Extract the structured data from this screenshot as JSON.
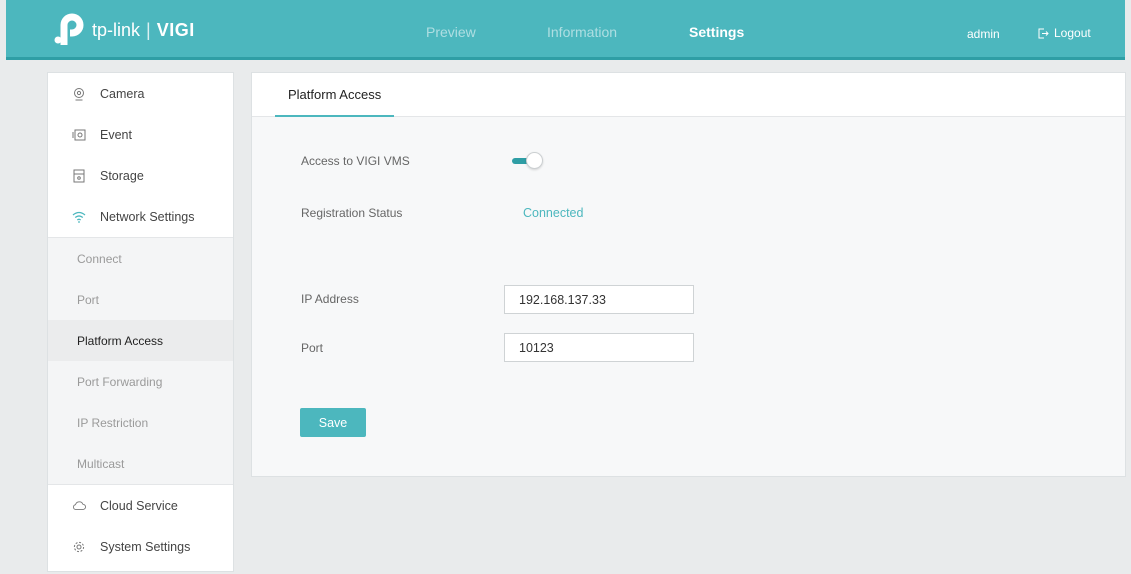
{
  "header": {
    "logo_brand": "tp-link",
    "logo_separator": "|",
    "logo_product": "VIGI",
    "nav": [
      {
        "label": "Preview",
        "active": false
      },
      {
        "label": "Information",
        "active": false
      },
      {
        "label": "Settings",
        "active": true
      }
    ],
    "user": "admin",
    "logout_label": "Logout",
    "colors": {
      "bar": "#4cb7be",
      "accent_dark": "#2f9ea5"
    }
  },
  "sidebar": {
    "items": [
      {
        "label": "Camera",
        "icon": "camera-icon"
      },
      {
        "label": "Event",
        "icon": "event-icon"
      },
      {
        "label": "Storage",
        "icon": "storage-icon"
      },
      {
        "label": "Network Settings",
        "icon": "wifi-icon"
      }
    ],
    "sub_items": [
      {
        "label": "Connect",
        "active": false
      },
      {
        "label": "Port",
        "active": false
      },
      {
        "label": "Platform Access",
        "active": true
      },
      {
        "label": "Port Forwarding",
        "active": false
      },
      {
        "label": "IP Restriction",
        "active": false
      },
      {
        "label": "Multicast",
        "active": false
      }
    ],
    "bottom_items": [
      {
        "label": "Cloud Service",
        "icon": "cloud-icon"
      },
      {
        "label": "System Settings",
        "icon": "gear-icon"
      }
    ]
  },
  "main": {
    "tab": "Platform Access",
    "access_label": "Access to VIGI VMS",
    "access_enabled": true,
    "status_label": "Registration Status",
    "status_value": "Connected",
    "ip_label": "IP Address",
    "ip_value": "192.168.137.33",
    "port_label": "Port",
    "port_value": "10123",
    "save_label": "Save"
  }
}
